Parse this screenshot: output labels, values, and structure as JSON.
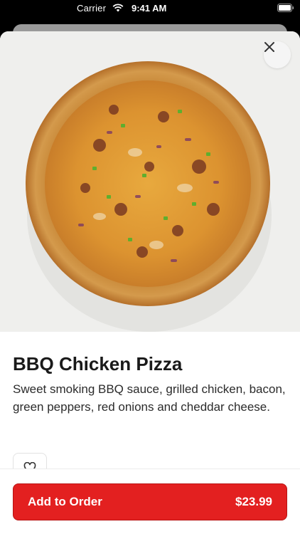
{
  "status_bar": {
    "carrier": "Carrier",
    "time": "9:41 AM"
  },
  "product": {
    "name": "BBQ Chicken Pizza",
    "description": "Sweet smoking BBQ sauce, grilled chicken, bacon, green peppers, red onions and cheddar cheese.",
    "image_icon": "pizza-photo"
  },
  "actions": {
    "add_label": "Add to Order",
    "price": "$23.99",
    "close_icon": "close-icon",
    "favorite_icon": "heart-icon"
  },
  "colors": {
    "accent": "#e32020",
    "text": "#1a1a1a"
  }
}
